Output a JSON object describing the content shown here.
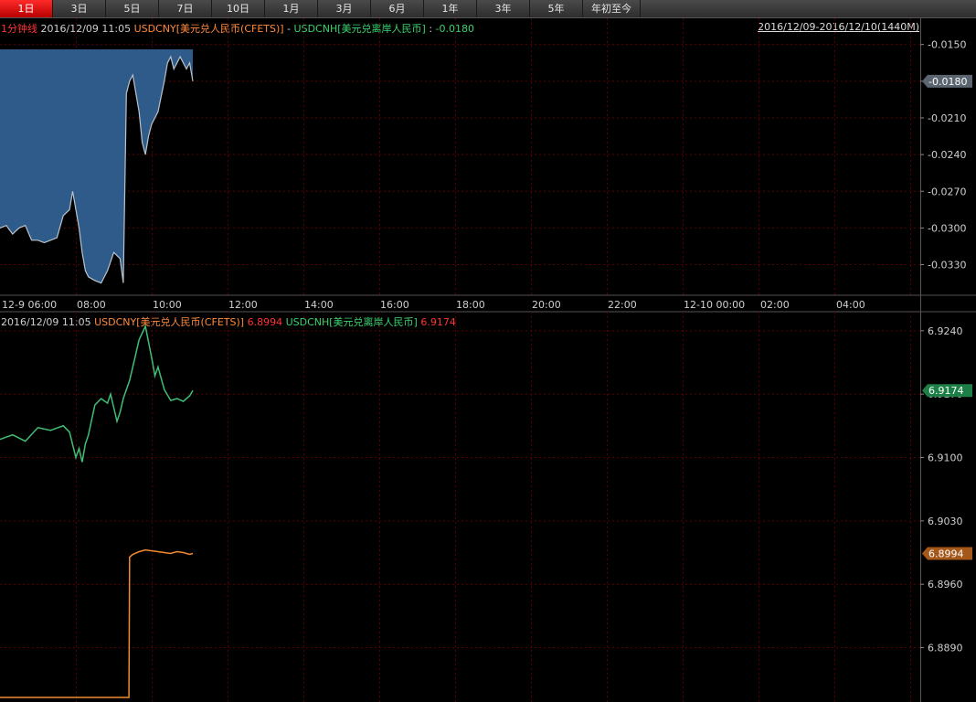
{
  "tabs": [
    "1日",
    "3日",
    "5日",
    "7日",
    "10日",
    "1月",
    "3月",
    "6月",
    "1年",
    "3年",
    "5年",
    "年初至今"
  ],
  "active_tab": "1日",
  "top_legend": {
    "interval": "1分钟线",
    "datetime": "2016/12/09 11:05",
    "series_a": "USDCNY[美元兑人民币(CFETS)]",
    "minus": " - ",
    "series_b": "USDCNH[美元兑离岸人民币]",
    "value_prefix": " : ",
    "value": "-0.0180",
    "range": "2016/12/09-2016/12/10(1440M)"
  },
  "bottom_legend": {
    "datetime": "2016/12/09 11:05",
    "series_a": "USDCNY[美元兑人民币(CFETS)]",
    "value_a": "6.8994",
    "series_b": "USDCNH[美元兑离岸人民币]",
    "value_b": "6.9174"
  },
  "colors": {
    "spread_fill": "#2f5b8a",
    "spread_line": "#b9c3cc",
    "usdcnh": "#3fbf76",
    "usdcny": "#f08a30",
    "grid": "#5a0000",
    "red_text": "#ff3333",
    "orange_text": "#ff8a3c",
    "green_text": "#3ad36e"
  },
  "chart_data": [
    {
      "type": "area",
      "series": [
        {
          "name": "USDCNY[美元兑人民币(CFETS)] - USDCNH[美元兑离岸人民币]",
          "x": [
            "06:00",
            "06:10",
            "06:20",
            "06:30",
            "06:40",
            "06:50",
            "07:00",
            "07:10",
            "07:20",
            "07:30",
            "07:40",
            "07:50",
            "07:55",
            "08:00",
            "08:05",
            "08:10",
            "08:15",
            "08:20",
            "08:30",
            "08:40",
            "08:50",
            "09:00",
            "09:10",
            "09:15",
            "09:20",
            "09:25",
            "09:30",
            "09:35",
            "09:40",
            "09:45",
            "09:50",
            "09:55",
            "10:00",
            "10:10",
            "10:20",
            "10:25",
            "10:30",
            "10:35",
            "10:40",
            "10:45",
            "10:50",
            "10:55",
            "11:00",
            "11:05"
          ],
          "values": [
            -0.03,
            -0.0298,
            -0.0305,
            -0.03,
            -0.0298,
            -0.031,
            -0.031,
            -0.0312,
            -0.031,
            -0.0308,
            -0.029,
            -0.0285,
            -0.027,
            -0.0285,
            -0.03,
            -0.032,
            -0.0335,
            -0.034,
            -0.0343,
            -0.0345,
            -0.0335,
            -0.032,
            -0.0325,
            -0.0345,
            -0.019,
            -0.018,
            -0.0175,
            -0.019,
            -0.0205,
            -0.023,
            -0.024,
            -0.0225,
            -0.0215,
            -0.0205,
            -0.018,
            -0.0165,
            -0.016,
            -0.017,
            -0.0165,
            -0.016,
            -0.0165,
            -0.017,
            -0.0165,
            -0.018
          ]
        }
      ],
      "ylim": [
        -0.0355,
        -0.0145
      ],
      "y_ticks": [
        "-0.0150",
        "-0.0180",
        "-0.0210",
        "-0.0240",
        "-0.0270",
        "-0.0300",
        "-0.0330"
      ],
      "last_value": "-0.0180",
      "x_ticks": [
        "12-9 06:00",
        "08:00",
        "10:00",
        "12:00",
        "14:00",
        "16:00",
        "18:00",
        "20:00",
        "22:00",
        "12-10 00:00",
        "02:00",
        "04:00"
      ]
    },
    {
      "type": "line",
      "series": [
        {
          "name": "USDCNH[美元兑离岸人民币]",
          "x": [
            "06:00",
            "06:20",
            "06:40",
            "07:00",
            "07:20",
            "07:40",
            "07:50",
            "08:00",
            "08:05",
            "08:10",
            "08:15",
            "08:20",
            "08:30",
            "08:40",
            "08:50",
            "08:55",
            "09:00",
            "09:05",
            "09:10",
            "09:15",
            "09:20",
            "09:25",
            "09:30",
            "09:40",
            "09:50",
            "10:00",
            "10:05",
            "10:10",
            "10:20",
            "10:30",
            "10:40",
            "10:50",
            "11:00",
            "11:05"
          ],
          "values": [
            6.912,
            6.9125,
            6.9118,
            6.9133,
            6.913,
            6.9135,
            6.9128,
            6.91,
            6.911,
            6.9095,
            6.9115,
            6.9125,
            6.9158,
            6.9165,
            6.916,
            6.917,
            6.9155,
            6.914,
            6.915,
            6.9165,
            6.9175,
            6.9185,
            6.92,
            6.923,
            6.9245,
            6.921,
            6.919,
            6.92,
            6.9175,
            6.9163,
            6.9165,
            6.9162,
            6.9168,
            6.9174
          ]
        },
        {
          "name": "USDCNY[美元兑人民币(CFETS)]",
          "x": [
            "06:00",
            "07:00",
            "08:00",
            "09:00",
            "09:24",
            "09:25",
            "09:30",
            "09:40",
            "09:50",
            "10:00",
            "10:10",
            "10:20",
            "10:30",
            "10:40",
            "10:50",
            "11:00",
            "11:05"
          ],
          "values": [
            6.8835,
            6.8835,
            6.8835,
            6.8835,
            6.8835,
            6.899,
            6.8993,
            6.8996,
            6.8998,
            6.8997,
            6.8996,
            6.8995,
            6.8994,
            6.8996,
            6.8995,
            6.8993,
            6.8994
          ]
        }
      ],
      "ylim": [
        6.883,
        6.926
      ],
      "y_ticks": [
        "6.9240",
        "6.9170",
        "6.9100",
        "6.9030",
        "6.8960",
        "6.8890"
      ],
      "last_values": [
        "6.9174",
        "6.8994"
      ]
    }
  ]
}
